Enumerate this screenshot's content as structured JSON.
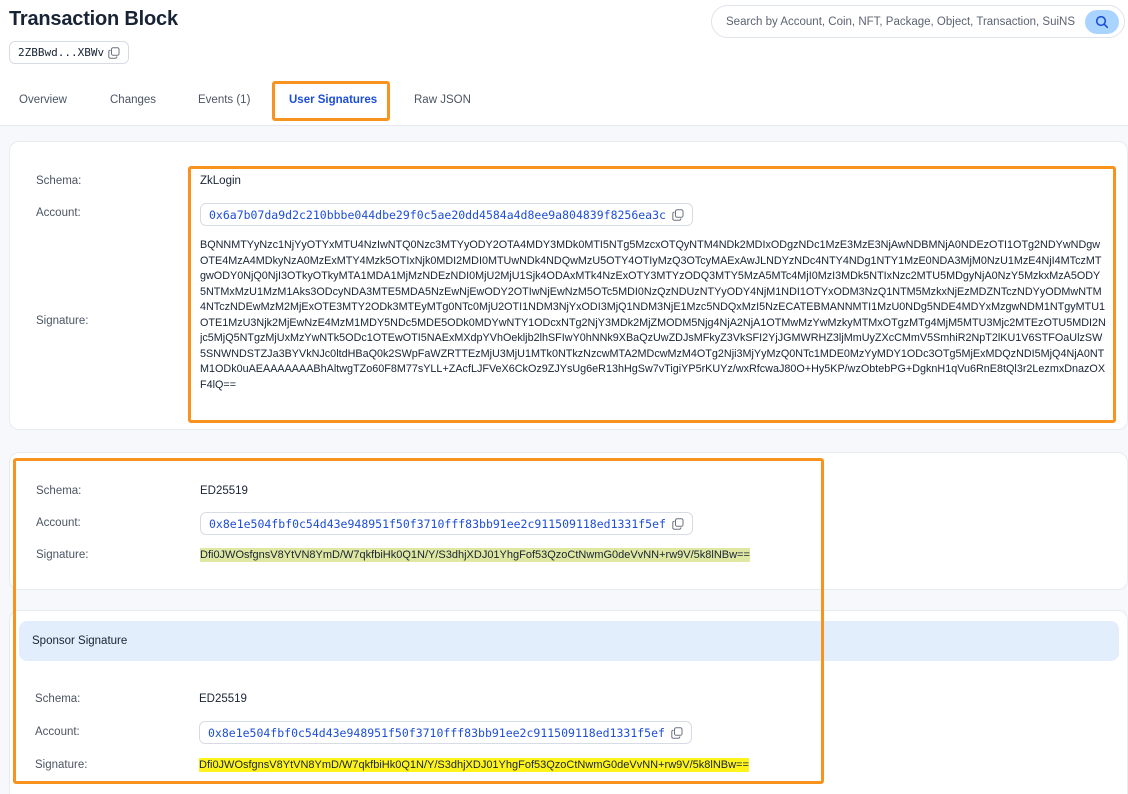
{
  "header": {
    "title": "Transaction Block",
    "digest_short": "2ZBBwd...XBWv"
  },
  "search": {
    "placeholder": "Search by Account, Coin, NFT, Package, Object, Transaction, SuiNS"
  },
  "tabs": [
    {
      "label": "Overview"
    },
    {
      "label": "Changes"
    },
    {
      "label": "Events (1)"
    },
    {
      "label": "User Signatures",
      "active": true
    },
    {
      "label": "Raw JSON"
    }
  ],
  "labels": {
    "schema": "Schema:",
    "account": "Account:",
    "signature": "Signature:"
  },
  "signatures": [
    {
      "schema": "ZkLogin",
      "account": "0x6a7b07da9d2c210bbbe044dbe29f0c5ae20dd4584a4d8ee9a804839f8256ea3c",
      "signature": "BQNNMTYyNzc1NjYyOTYxMTU4NzIwNTQ0Nzc3MTYyODY2OTA4MDY3MDk0MTI5NTg5MzcxOTQyNTM4NDk2MDIxODgzNDc1MzE3MzE3NjAwNDBMNjA0NDEzOTI1OTg2NDYwNDgwOTE4MzA4MDkyNzA0MzExMTY4Mzk5OTIxNjk0MDI2MDI0MTUwNDk4NDQwMzU5OTY4OTIyMzQ3OTcyMAExAwJLNDYzNDc4NTY4NDg1NTY1MzE0NDA3MjM0NzU1MzE4NjI4MTczMTgwODY0NjQ0NjI3OTkyOTkyMTA1MDA1MjMzNDEzNDI0MjU2MjU1Sjk4ODAxMTk4NzExOTY3MTYzODQ3MTY5MzA5MTc4MjI0MzI3MDk5NTIxNzc2MTU5MDgyNjA0NzY5MzkxMzA5ODY5NTMxMzU1MzM1Aks3ODcyNDA3MTE5MDA5NzEwNjEwODY2OTIwNjEwNzM5OTc5MDI0NzQzNDUzNTYyODY4NjM1NDI1OTYxODM3NzQ1NTM5MzkxNjEzMDZNTczNDYyODMwNTM4NTczNDEwMzM2MjExOTE3MTY2ODk3MTEyMTg0NTc0MjU2OTI1NDM3NjYxODI3MjQ1NDM3NjE1Mzc5NDQxMzI5NzECATEBMANNMTI1MzU0NDg5NDE4MDYxMzgwNDM1NTgyMTU1OTE1MzU3Njk2MjEwNzE4MzM1MDY5NDc5MDE5ODk0MDYwNTY1ODcxNTg2NjY3MDk2MjZMODM5Njg4NjA2NjA1OTMwMzYwMzkyMTMxOTgzMTg4MjM5MTU3Mjc2MTEzOTU5MDI2Njc5MjQ5NTgzMjUxMzYwNTk5ODc1OTEwOTI5NAExMXdpYVhOekljb2lhSFIwY0hNNk9XBaQzUwZDJsMFkyZ3VkSFI2YjJGMWRHZ3ljMmUyZXcCMmV5SmhiR2NpT2lKU1V6STFOaUlzSW5SNWNDSTZJa3BYVkNJc0ltdHBaQ0k2SWpFaWZRTTEzMjU3MjU1MTk0NTkzNzcwMTA2MDcwMzM4OTg2Nji3MjYyMzQ0NTc1MDE0MzYyMDY1ODc3OTg5MjExMDQzNDI5MjQ4NjA0NTM1ODk0uAEAAAAAAABhAltwgTZo60F8M77sYLL+ZAcfLJFVeX6CkOz9ZJYsUg6eR13hHgSw7vTigiYP5rKUYz/wxRfcwaJ80O+Hy5KP/wzObtebPG+DgknH1qVu6RnE8tQl3r2LezmxDnazOXF4lQ=="
    },
    {
      "schema": "ED25519",
      "account": "0x8e1e504fbf0c54d43e948951f50f3710fff83bb91ee2c911509118ed1331f5ef",
      "signature": "Dfi0JWOsfgnsV8YtVN8YmD/W7qkfbiHk0Q1N/Y/S3dhjXDJ01YhgFof53QzoCtNwmG0deVvNN+rw9V/5k8lNBw=="
    }
  ],
  "sponsor": {
    "title": "Sponsor Signature",
    "schema": "ED25519",
    "account": "0x8e1e504fbf0c54d43e948951f50f3710fff83bb91ee2c911509118ed1331f5ef",
    "signature": "Dfi0JWOsfgnsV8YtVN8YmD/W7qkfbiHk0Q1N/Y/S3dhjXDJ01YhgFof53QzoCtNwmG0deVvNN+rw9V/5k8lNBw=="
  },
  "colors": {
    "highlight": "#f7931e",
    "accent": "#1d4ed8",
    "marker_soft": "#dfe7a2",
    "marker_strong": "#fff31c"
  },
  "icons": [
    "copy-icon",
    "search-icon"
  ]
}
